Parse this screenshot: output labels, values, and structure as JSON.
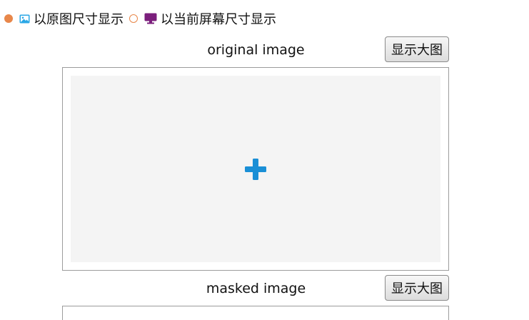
{
  "view_mode": {
    "options": [
      {
        "label": "以原图尺寸显示",
        "checked": true,
        "icon": "image-icon"
      },
      {
        "label": "以当前屏幕尺寸显示",
        "checked": false,
        "icon": "monitor-icon"
      }
    ]
  },
  "sections": {
    "original": {
      "title": "original image",
      "button_label": "显示大图"
    },
    "masked": {
      "title": "masked image",
      "button_label": "显示大图"
    }
  },
  "upload": {
    "icon": "plus-icon",
    "icon_color": "#1a8fd6"
  },
  "colors": {
    "radio_accent": "#e8874a",
    "image_icon": "#2aa7e6",
    "monitor_icon": "#7b1f7c",
    "drop_area_bg": "#f4f4f4"
  }
}
